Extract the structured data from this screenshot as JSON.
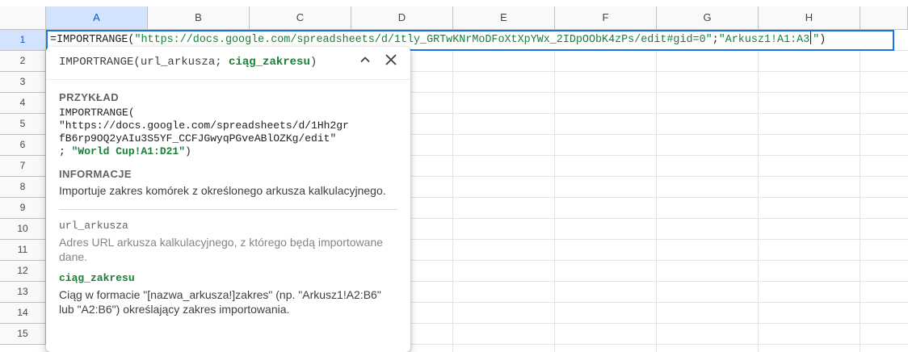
{
  "columns": [
    "A",
    "B",
    "C",
    "D",
    "E",
    "F",
    "G",
    "H"
  ],
  "rows": [
    "1",
    "2",
    "3",
    "4",
    "5",
    "6",
    "7",
    "8",
    "9",
    "10",
    "11",
    "12",
    "13",
    "14",
    "15"
  ],
  "formula": {
    "prefix": "=IMPORTRANGE(",
    "arg1": "\"https://docs.google.com/spreadsheets/d/1tly_GRTwKNrMoDFoXtXpYWx_2IDpOObK4zPs/edit#gid=0\"",
    "sep": ";",
    "arg2_before_caret": "\"Arkusz1!A1:A3",
    "arg2_after_caret": "\"",
    "suffix": ")"
  },
  "popup": {
    "signature_start": "IMPORTRANGE(url_arkusza; ",
    "signature_active": "ciąg_zakresu",
    "signature_end": ")",
    "example_title": "PRZYKŁAD",
    "example_code": "IMPORTRANGE(\n\"https://docs.google.com/spreadsheets/d/1Hh2gr\nfB6rp9OQ2yAIu3S5YF_CCFJGwyqPGveABlOZKg/edit\"\n; ",
    "example_range": "\"World Cup!A1:D21\"",
    "example_end": ")",
    "info_title": "INFORMACJE",
    "info_text": "Importuje zakres komórek z określonego arkusza kalkulacyjnego.",
    "args": [
      {
        "name": "url_arkusza",
        "desc": "Adres URL arkusza kalkulacyjnego, z którego będą importowane dane."
      },
      {
        "name": "ciąg_zakresu",
        "desc": "Ciąg w formacie \"[nazwa_arkusza!]zakres\" (np. \"Arkusz1!A2:B6\" lub \"A2:B6\") określający zakres importowania."
      }
    ]
  },
  "icons": {
    "collapse": "chevron-up-icon",
    "close": "close-icon"
  },
  "colors": {
    "accent": "#1a73e8",
    "string": "#188038",
    "header_selected": "#d3e3fd"
  }
}
